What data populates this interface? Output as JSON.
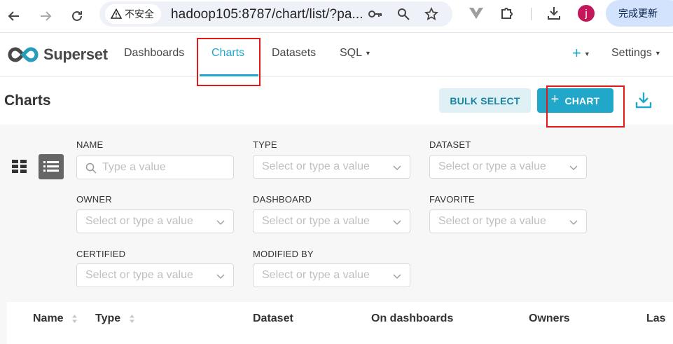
{
  "browser": {
    "security_label": "不安全",
    "url": "hadoop105:8787/chart/list/?pa...",
    "avatar_initial": "j",
    "update_label": "完成更新"
  },
  "nav": {
    "logo_text": "Superset",
    "items": [
      {
        "label": "Dashboards"
      },
      {
        "label": "Charts",
        "active": true
      },
      {
        "label": "Datasets"
      },
      {
        "label": "SQL"
      }
    ],
    "plus_label": "+",
    "settings_label": "Settings"
  },
  "header": {
    "title": "Charts",
    "bulk_select_label": "BULK SELECT",
    "add_chart_label": "CHART",
    "add_chart_plus": "+"
  },
  "filters": {
    "name": {
      "label": "NAME",
      "placeholder": "Type a value"
    },
    "type": {
      "label": "TYPE",
      "placeholder": "Select or type a value"
    },
    "dataset": {
      "label": "DATASET",
      "placeholder": "Select or type a value"
    },
    "owner": {
      "label": "OWNER",
      "placeholder": "Select or type a value"
    },
    "dashboard": {
      "label": "DASHBOARD",
      "placeholder": "Select or type a value"
    },
    "favorite": {
      "label": "FAVORITE",
      "placeholder": "Select or type a value"
    },
    "certified": {
      "label": "CERTIFIED",
      "placeholder": "Select or type a value"
    },
    "modified_by": {
      "label": "MODIFIED BY",
      "placeholder": "Select or type a value"
    }
  },
  "table": {
    "columns": [
      "Name",
      "Type",
      "Dataset",
      "On dashboards",
      "Owners",
      "Las"
    ]
  },
  "colors": {
    "accent": "#20a7c9",
    "highlight_box": "#e0191b",
    "bulk_bg": "#e0f1f6"
  }
}
